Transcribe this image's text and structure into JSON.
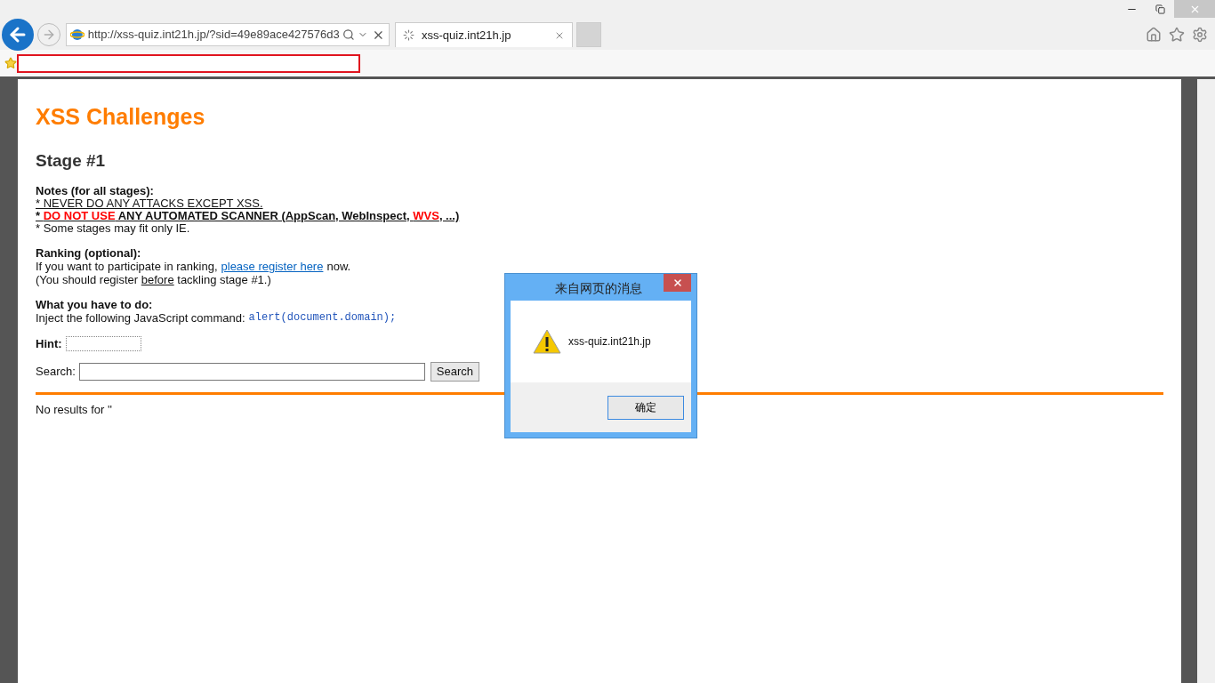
{
  "browser": {
    "address": "http://xss-quiz.int21h.jp/?sid=49e89ace427576d3",
    "tabs": [
      {
        "title": "xss-quiz.int21h.jp",
        "selected": true
      }
    ]
  },
  "page": {
    "title": "XSS Challenges",
    "stage": "Stage #1",
    "notes": {
      "heading": "Notes (for all stages):",
      "lines": [
        {
          "bold": false,
          "underline": true,
          "parts": [
            {
              "text": "* NEVER DO ANY ATTACKS EXCEPT XSS.",
              "alert": false
            }
          ]
        },
        {
          "bold": true,
          "underline": true,
          "parts": [
            {
              "text": "* ",
              "alert": false
            },
            {
              "text": "DO NOT USE",
              "alert": true
            },
            {
              "text": " ANY AUTOMATED SCANNER (AppScan, WebInspect, ",
              "alert": false
            },
            {
              "text": "WVS",
              "alert": true
            },
            {
              "text": ", ...)",
              "alert": false
            }
          ]
        },
        {
          "bold": false,
          "underline": false,
          "parts": [
            {
              "text": "* Some stages may fit only IE.",
              "alert": false
            }
          ]
        }
      ]
    },
    "ranking": {
      "heading": "Ranking (optional):",
      "before_link": "If you want to participate in ranking,",
      "link": "please register here",
      "after_link": "now.",
      "note_start": "(You should register",
      "note_underlined": "before",
      "note_end": "tackling stage #1.)"
    },
    "task": {
      "heading": "What you have to do:",
      "text": "Inject the following JavaScript command:",
      "code": "alert(document.domain);"
    },
    "hint": {
      "label": "Hint:"
    },
    "search": {
      "label": "Search:",
      "button": "Search"
    },
    "result": "No results for ''"
  },
  "dialog": {
    "title": "来自网页的消息",
    "message": "xss-quiz.int21h.jp",
    "ok": "确定"
  }
}
